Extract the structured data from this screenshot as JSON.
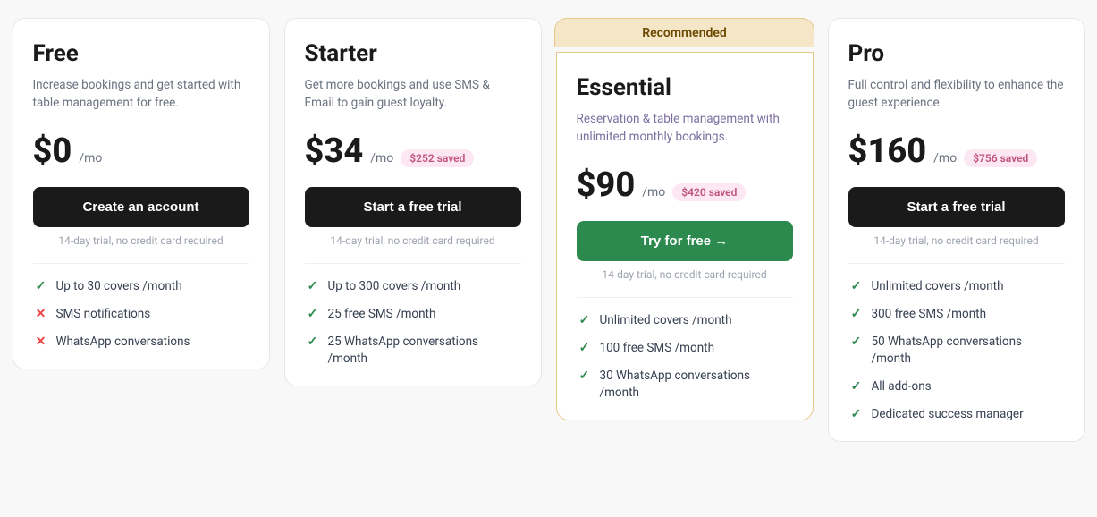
{
  "plans": [
    {
      "id": "free",
      "name": "Free",
      "description": "Increase bookings and get started with table management for free.",
      "descriptionClass": "",
      "price": "$0",
      "pricePer": "/mo",
      "savings": null,
      "ctaLabel": "Create an account",
      "ctaStyle": "dark",
      "trialNote": "14-day trial, no credit card required",
      "recommended": false,
      "features": [
        {
          "icon": "check",
          "text": "Up to 30 covers /month"
        },
        {
          "icon": "cross",
          "text": "SMS notifications"
        },
        {
          "icon": "cross",
          "text": "WhatsApp conversations"
        }
      ]
    },
    {
      "id": "starter",
      "name": "Starter",
      "description": "Get more bookings and use SMS & Email to gain guest loyalty.",
      "descriptionClass": "",
      "price": "$34",
      "pricePer": "/mo",
      "savings": "$252 saved",
      "ctaLabel": "Start a free trial",
      "ctaStyle": "dark",
      "trialNote": "14-day trial, no credit card required",
      "recommended": false,
      "features": [
        {
          "icon": "check",
          "text": "Up to 300 covers /month"
        },
        {
          "icon": "check",
          "text": "25 free SMS /month"
        },
        {
          "icon": "check",
          "text": "25 WhatsApp conversations /month"
        }
      ]
    },
    {
      "id": "essential",
      "name": "Essential",
      "description": "Reservation & table management with unlimited monthly bookings.",
      "descriptionClass": "highlight",
      "price": "$90",
      "pricePer": "/mo",
      "savings": "$420 saved",
      "ctaLabel": "Try for free →",
      "ctaStyle": "green",
      "trialNote": "14-day trial, no credit card required",
      "recommended": true,
      "recommendedLabel": "Recommended",
      "features": [
        {
          "icon": "check",
          "text": "Unlimited covers /month"
        },
        {
          "icon": "check",
          "text": "100 free SMS /month"
        },
        {
          "icon": "check",
          "text": "30 WhatsApp conversations /month"
        }
      ]
    },
    {
      "id": "pro",
      "name": "Pro",
      "description": "Full control and flexibility to enhance the guest experience.",
      "descriptionClass": "",
      "price": "$160",
      "pricePer": "/mo",
      "savings": "$756 saved",
      "ctaLabel": "Start a free trial",
      "ctaStyle": "dark",
      "trialNote": "14-day trial, no credit card required",
      "recommended": false,
      "features": [
        {
          "icon": "check",
          "text": "Unlimited covers /month"
        },
        {
          "icon": "check",
          "text": "300 free SMS /month"
        },
        {
          "icon": "check",
          "text": "50 WhatsApp conversations /month"
        },
        {
          "icon": "check",
          "text": "All add-ons"
        },
        {
          "icon": "check",
          "text": "Dedicated success manager"
        }
      ]
    }
  ]
}
